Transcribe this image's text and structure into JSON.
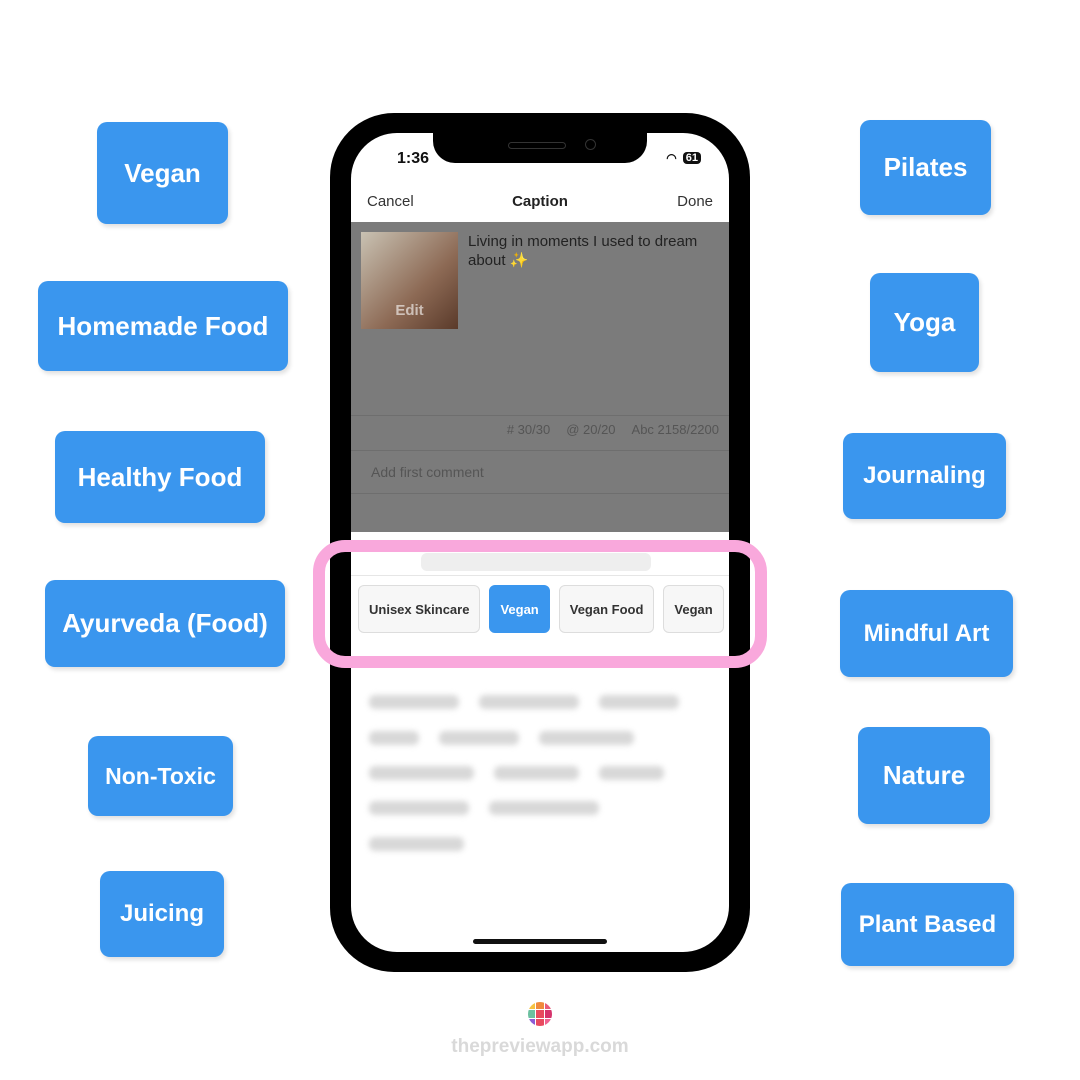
{
  "left_tags": [
    "Vegan",
    "Homemade Food",
    "Healthy Food",
    "Ayurveda (Food)",
    "Non-Toxic",
    "Juicing"
  ],
  "right_tags": [
    "Pilates",
    "Yoga",
    "Journaling",
    "Mindful Art",
    "Nature",
    "Plant Based"
  ],
  "status": {
    "time": "1:36",
    "battery": "61"
  },
  "nav": {
    "cancel": "Cancel",
    "title": "Caption",
    "done": "Done"
  },
  "post": {
    "edit": "Edit",
    "caption": "Living in moments I used to dream about ✨"
  },
  "counts": {
    "hashtags": "# 30/30",
    "mentions": "@ 20/20",
    "chars": "Abc 2158/2200"
  },
  "comment_placeholder": "Add first comment",
  "chips": [
    "Unisex Skincare",
    "Vegan",
    "Vegan Food",
    "Vegan"
  ],
  "selected_chip": "Vegan",
  "footer": "thepreviewapp.com",
  "colors": {
    "tag": "#3a96ee",
    "highlight": "#f9a8dc"
  }
}
